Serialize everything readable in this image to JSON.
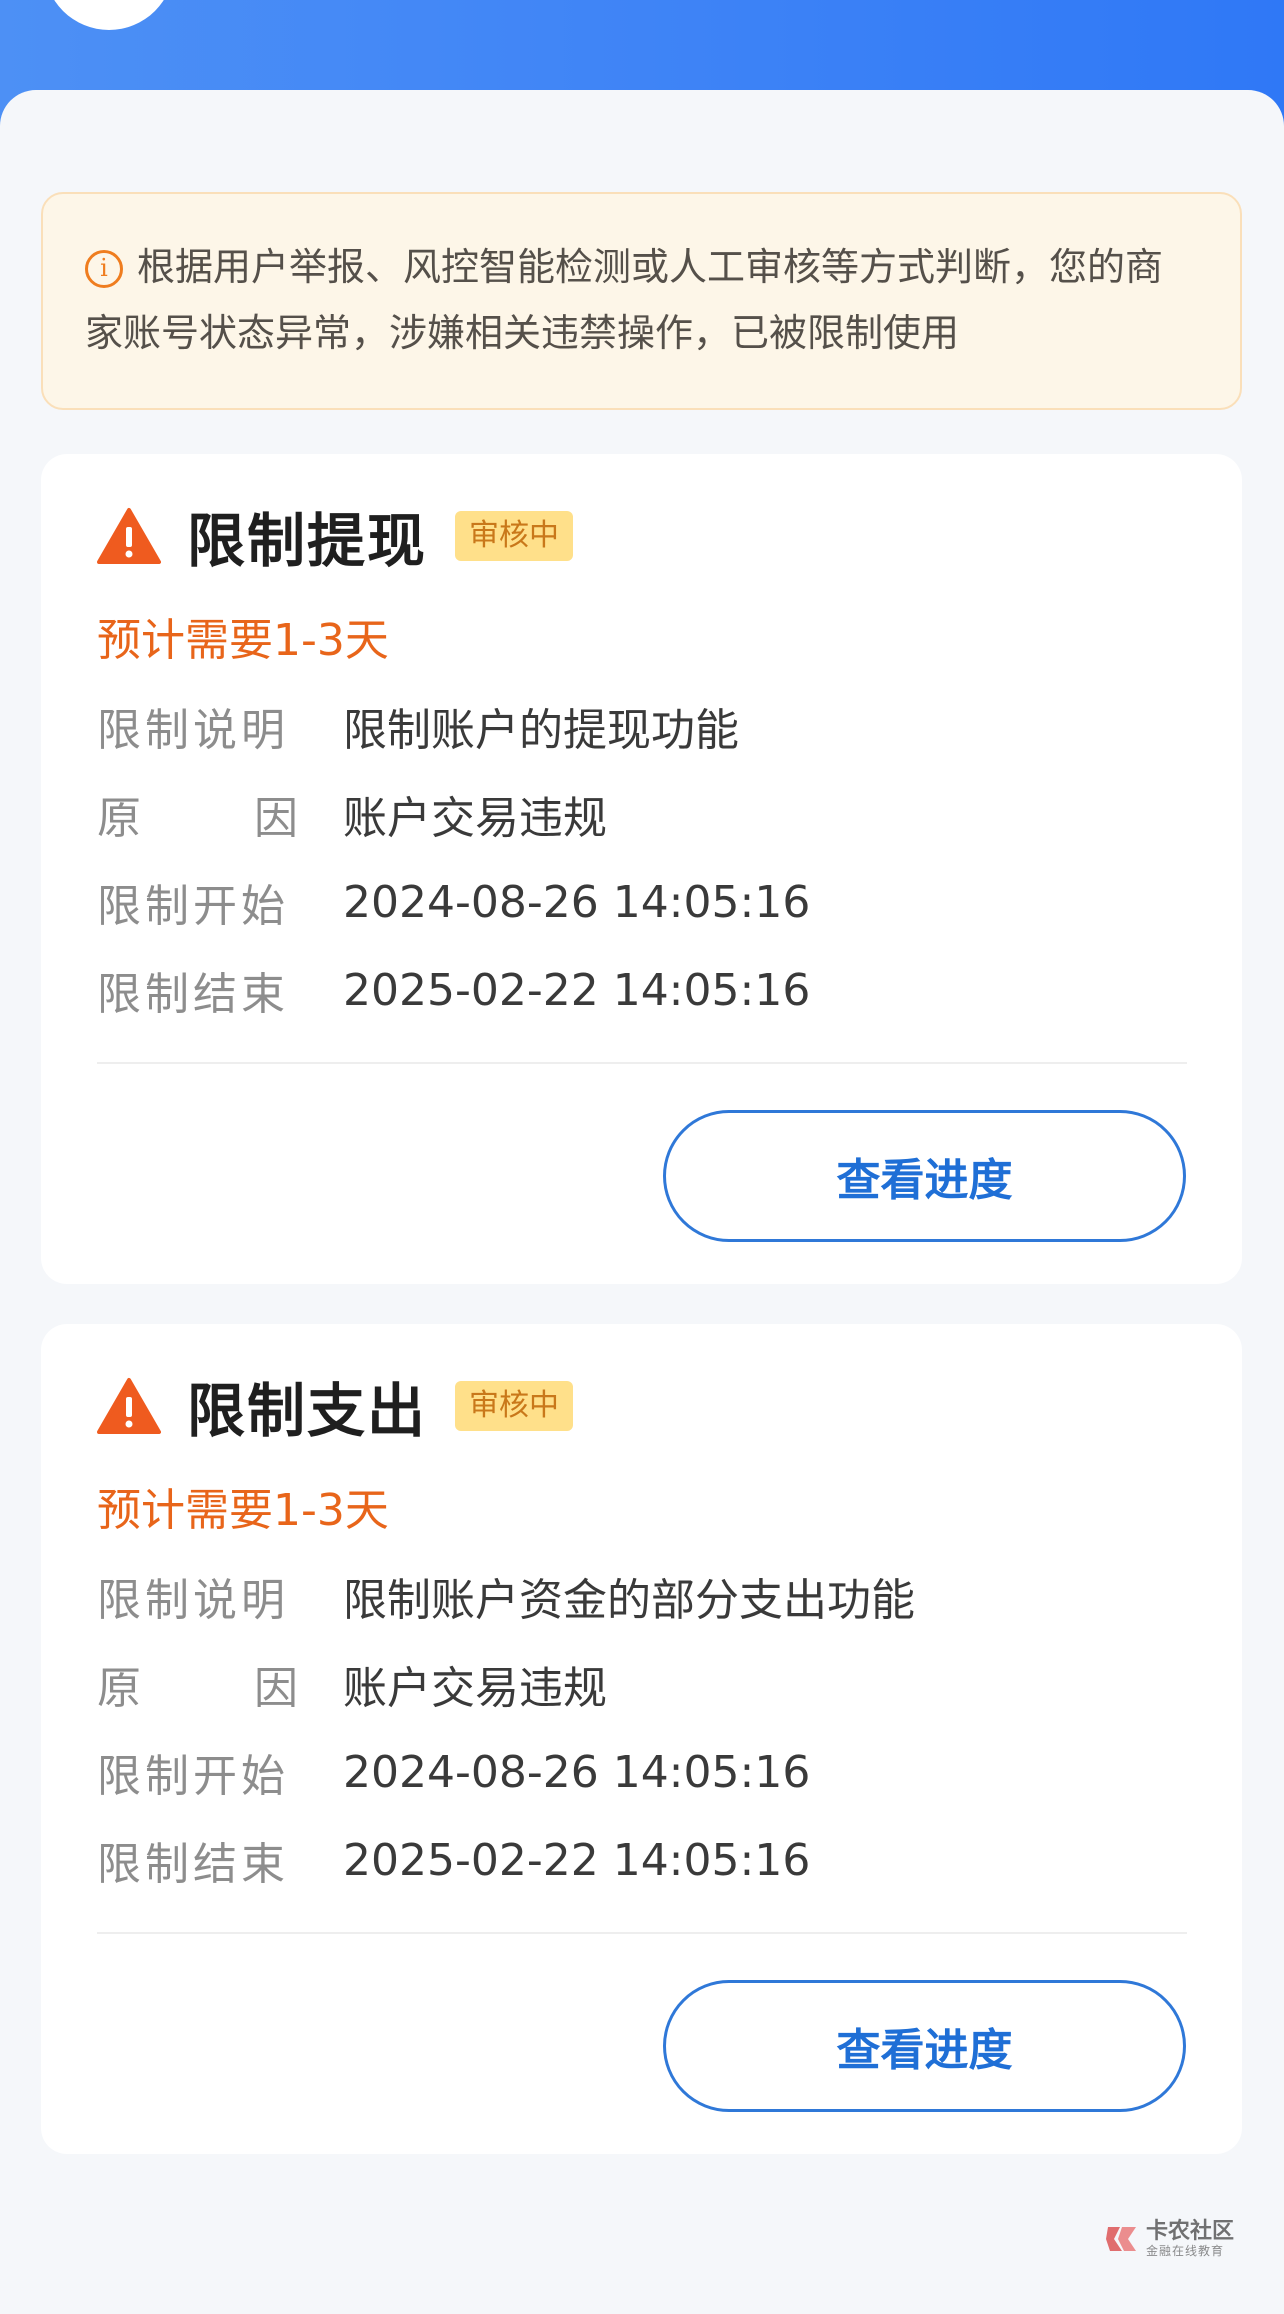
{
  "notice": {
    "text": "根据用户举报、风控智能检测或人工审核等方式判断，您的商家账号状态异常，涉嫌相关违禁操作，已被限制使用",
    "icon": "info-circle-icon"
  },
  "cards": [
    {
      "title": "限制提现",
      "status": "审核中",
      "estimate": "预计需要1-3天",
      "rows": [
        {
          "label": "限制说明",
          "value": "限制账户的提现功能"
        },
        {
          "label_left": "原",
          "label_right": "因",
          "value": "账户交易违规"
        },
        {
          "label": "限制开始",
          "value": "2024-08-26 14:05:16"
        },
        {
          "label": "限制结束",
          "value": "2025-02-22 14:05:16"
        }
      ],
      "button": "查看进度"
    },
    {
      "title": "限制支出",
      "status": "审核中",
      "estimate": "预计需要1-3天",
      "rows": [
        {
          "label": "限制说明",
          "value": "限制账户资金的部分支出功能"
        },
        {
          "label_left": "原",
          "label_right": "因",
          "value": "账户交易违规"
        },
        {
          "label": "限制开始",
          "value": "2024-08-26 14:05:16"
        },
        {
          "label": "限制结束",
          "value": "2025-02-22 14:05:16"
        }
      ],
      "button": "查看进度"
    }
  ],
  "watermark": {
    "title": "卡农社区",
    "subtitle": "金融在线教育"
  },
  "colors": {
    "header_blue": "#3f84f6",
    "warning_orange": "#ef5b1f",
    "estimate_orange": "#e8651a",
    "badge_yellow": "#ffe08a",
    "button_blue": "#1f6fd6"
  }
}
